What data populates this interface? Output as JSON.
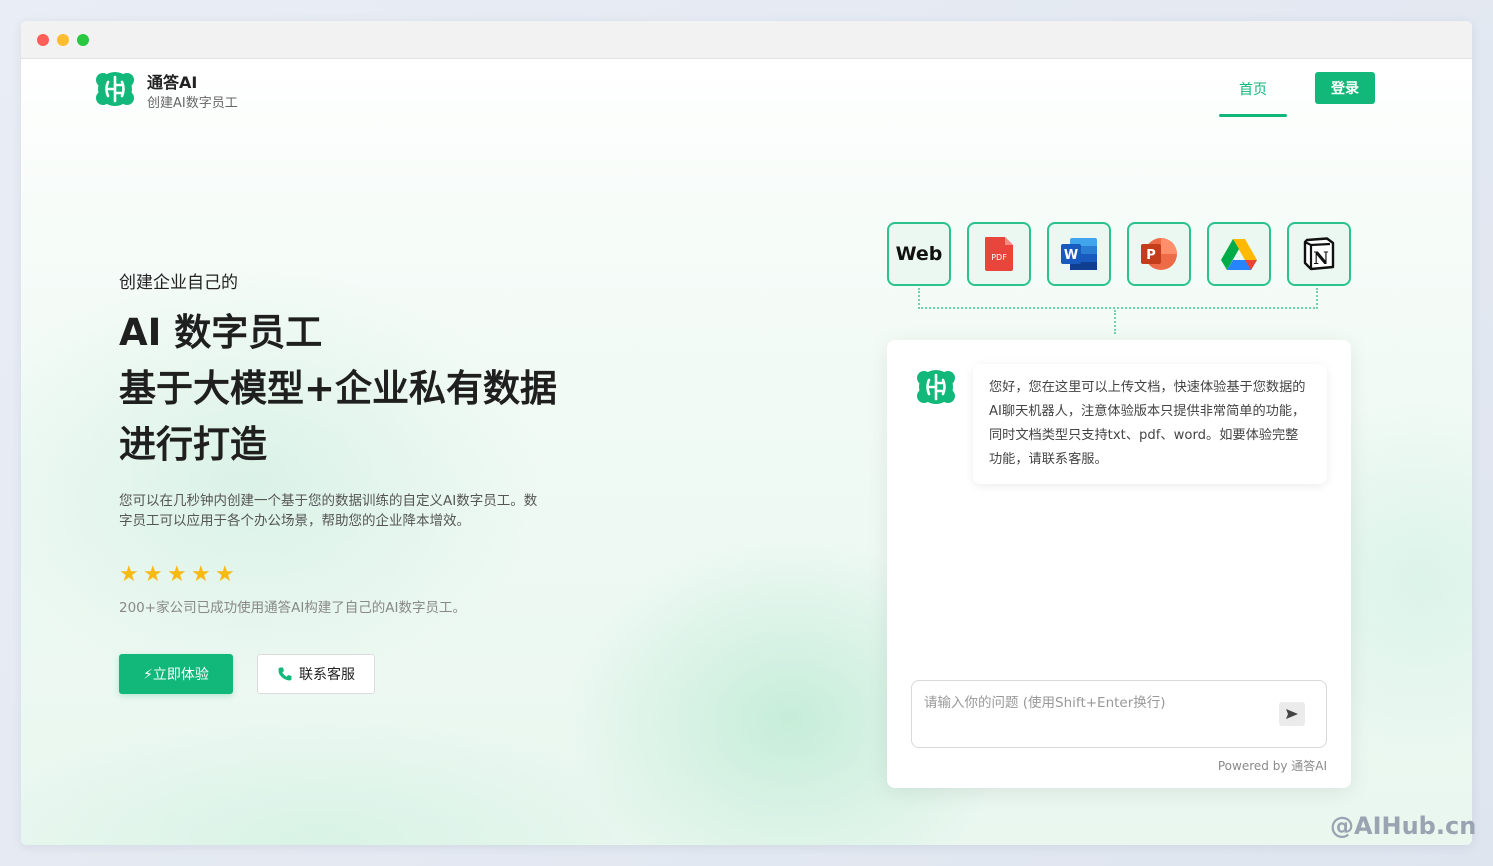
{
  "brand": {
    "name": "通答AI",
    "tagline": "创建AI数字员工",
    "logo_icon": "brain-icon",
    "accent": "#12b879"
  },
  "nav": {
    "home": "首页",
    "login": "登录"
  },
  "hero": {
    "kicker": "创建企业自己的",
    "title_lines": [
      "AI 数字员工",
      "基于大模型+企业私有数据",
      "进行打造"
    ],
    "description": "您可以在几秒钟内创建一个基于您的数据训练的自定义AI数字员工。数字员工可以应用于各个办公场景，帮助您的企业降本增效。",
    "rating": 5,
    "social_proof": "200+家公司已成功使用通答AI构建了自己的AI数字员工。",
    "primary_cta": "⚡立即体验",
    "secondary_cta": "联系客服"
  },
  "integrations": [
    {
      "label": "Web",
      "icon": "web-icon"
    },
    {
      "label": "PDF",
      "icon": "pdf-icon"
    },
    {
      "label": "W",
      "icon": "word-icon"
    },
    {
      "label": "P",
      "icon": "powerpoint-icon"
    },
    {
      "label": "",
      "icon": "google-drive-icon"
    },
    {
      "label": "N",
      "icon": "notion-icon"
    }
  ],
  "chat": {
    "greeting": "您好，您在这里可以上传文档，快速体验基于您数据的AI聊天机器人，注意体验版本只提供非常简单的功能，同时文档类型只支持txt、pdf、word。如要体验完整功能，请联系客服。",
    "input_placeholder": "请输入你的问题 (使用Shift+Enter换行)",
    "powered_by": "Powered by 通答AI"
  },
  "watermark": "@AIHub.cn"
}
